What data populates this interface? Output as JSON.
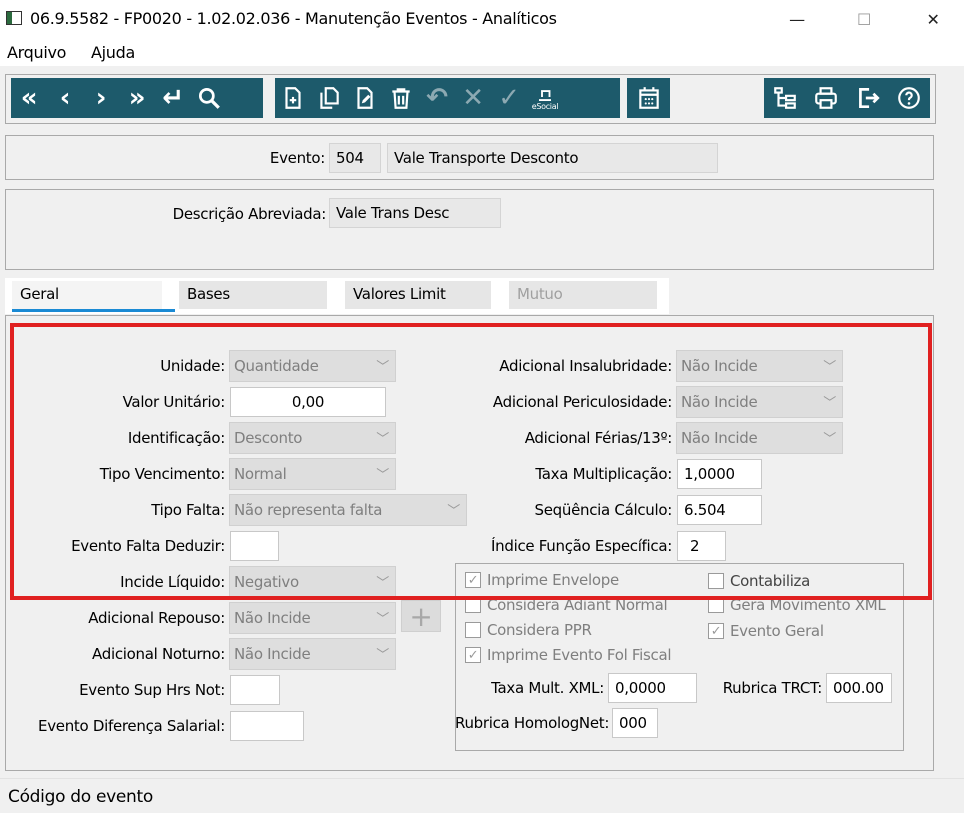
{
  "window": {
    "title": "06.9.5582 - FP0020 - 1.02.02.036 - Manutenção Eventos - Analíticos",
    "min": "—",
    "max": "☐",
    "close": "✕"
  },
  "menu": {
    "file": "Arquivo",
    "help": "Ajuda"
  },
  "toolbar": {
    "esocial_label": "eSocial"
  },
  "header": {
    "evento_label": "Evento:",
    "evento_code": "504",
    "evento_name": "Vale Transporte Desconto",
    "desc_label": "Descrição Abreviada:",
    "desc_value": "Vale Trans Desc"
  },
  "tabs": {
    "geral": "Geral",
    "bases": "Bases",
    "valores": "Valores Limit",
    "mutuo": "Mutuo"
  },
  "left": {
    "unidade_label": "Unidade:",
    "unidade_value": "Quantidade",
    "valor_label": "Valor Unitário:",
    "valor_value": "0,00",
    "ident_label": "Identificação:",
    "ident_value": "Desconto",
    "tipovenc_label": "Tipo Vencimento:",
    "tipovenc_value": "Normal",
    "tipofalta_label": "Tipo Falta:",
    "tipofalta_value": "Não representa falta",
    "faltaded_label": "Evento Falta Deduzir:",
    "faltaded_value": "",
    "incliq_label": "Incide Líquido:",
    "incliq_value": "Negativo",
    "repouso_label": "Adicional Repouso:",
    "repouso_value": "Não Incide",
    "noturno_label": "Adicional Noturno:",
    "noturno_value": "Não Incide",
    "suphrs_label": "Evento Sup Hrs Not:",
    "suphrs_value": "",
    "difsal_label": "Evento Diferença Salarial:",
    "difsal_value": ""
  },
  "right": {
    "insal_label": "Adicional Insalubridade:",
    "insal_value": "Não Incide",
    "peric_label": "Adicional Periculosidade:",
    "peric_value": "Não Incide",
    "ferias_label": "Adicional Férias/13º:",
    "ferias_value": "Não Incide",
    "taxa_label": "Taxa Multiplicação:",
    "taxa_value": "1,0000",
    "seq_label": "Seqüência Cálculo:",
    "seq_value": "6.504",
    "indice_label": "Índice Função Específica:",
    "indice_value": "2"
  },
  "checks": {
    "imprime_env": "Imprime Envelope",
    "contabiliza": "Contabiliza",
    "considera_adiant": "Considera Adiant Normal",
    "gera_mov": "Gera Movimento XML",
    "considera_ppr": "Considera PPR",
    "evento_geral": "Evento Geral",
    "imprime_fol": "Imprime Evento Fol Fiscal",
    "checkmark": "✓",
    "taxa_xml_label": "Taxa Mult. XML:",
    "taxa_xml_value": "0,0000",
    "rubrica_trct_label": "Rubrica TRCT:",
    "rubrica_trct_value": "000.00",
    "rubrica_hom_label": "Rubrica HomologNet:",
    "rubrica_hom_value": "000"
  },
  "status": {
    "text": "Código do evento"
  },
  "colors": {
    "toolbar": "#1d5a6b",
    "highlight": "#e02020",
    "tab_accent": "#1a8ad4"
  }
}
